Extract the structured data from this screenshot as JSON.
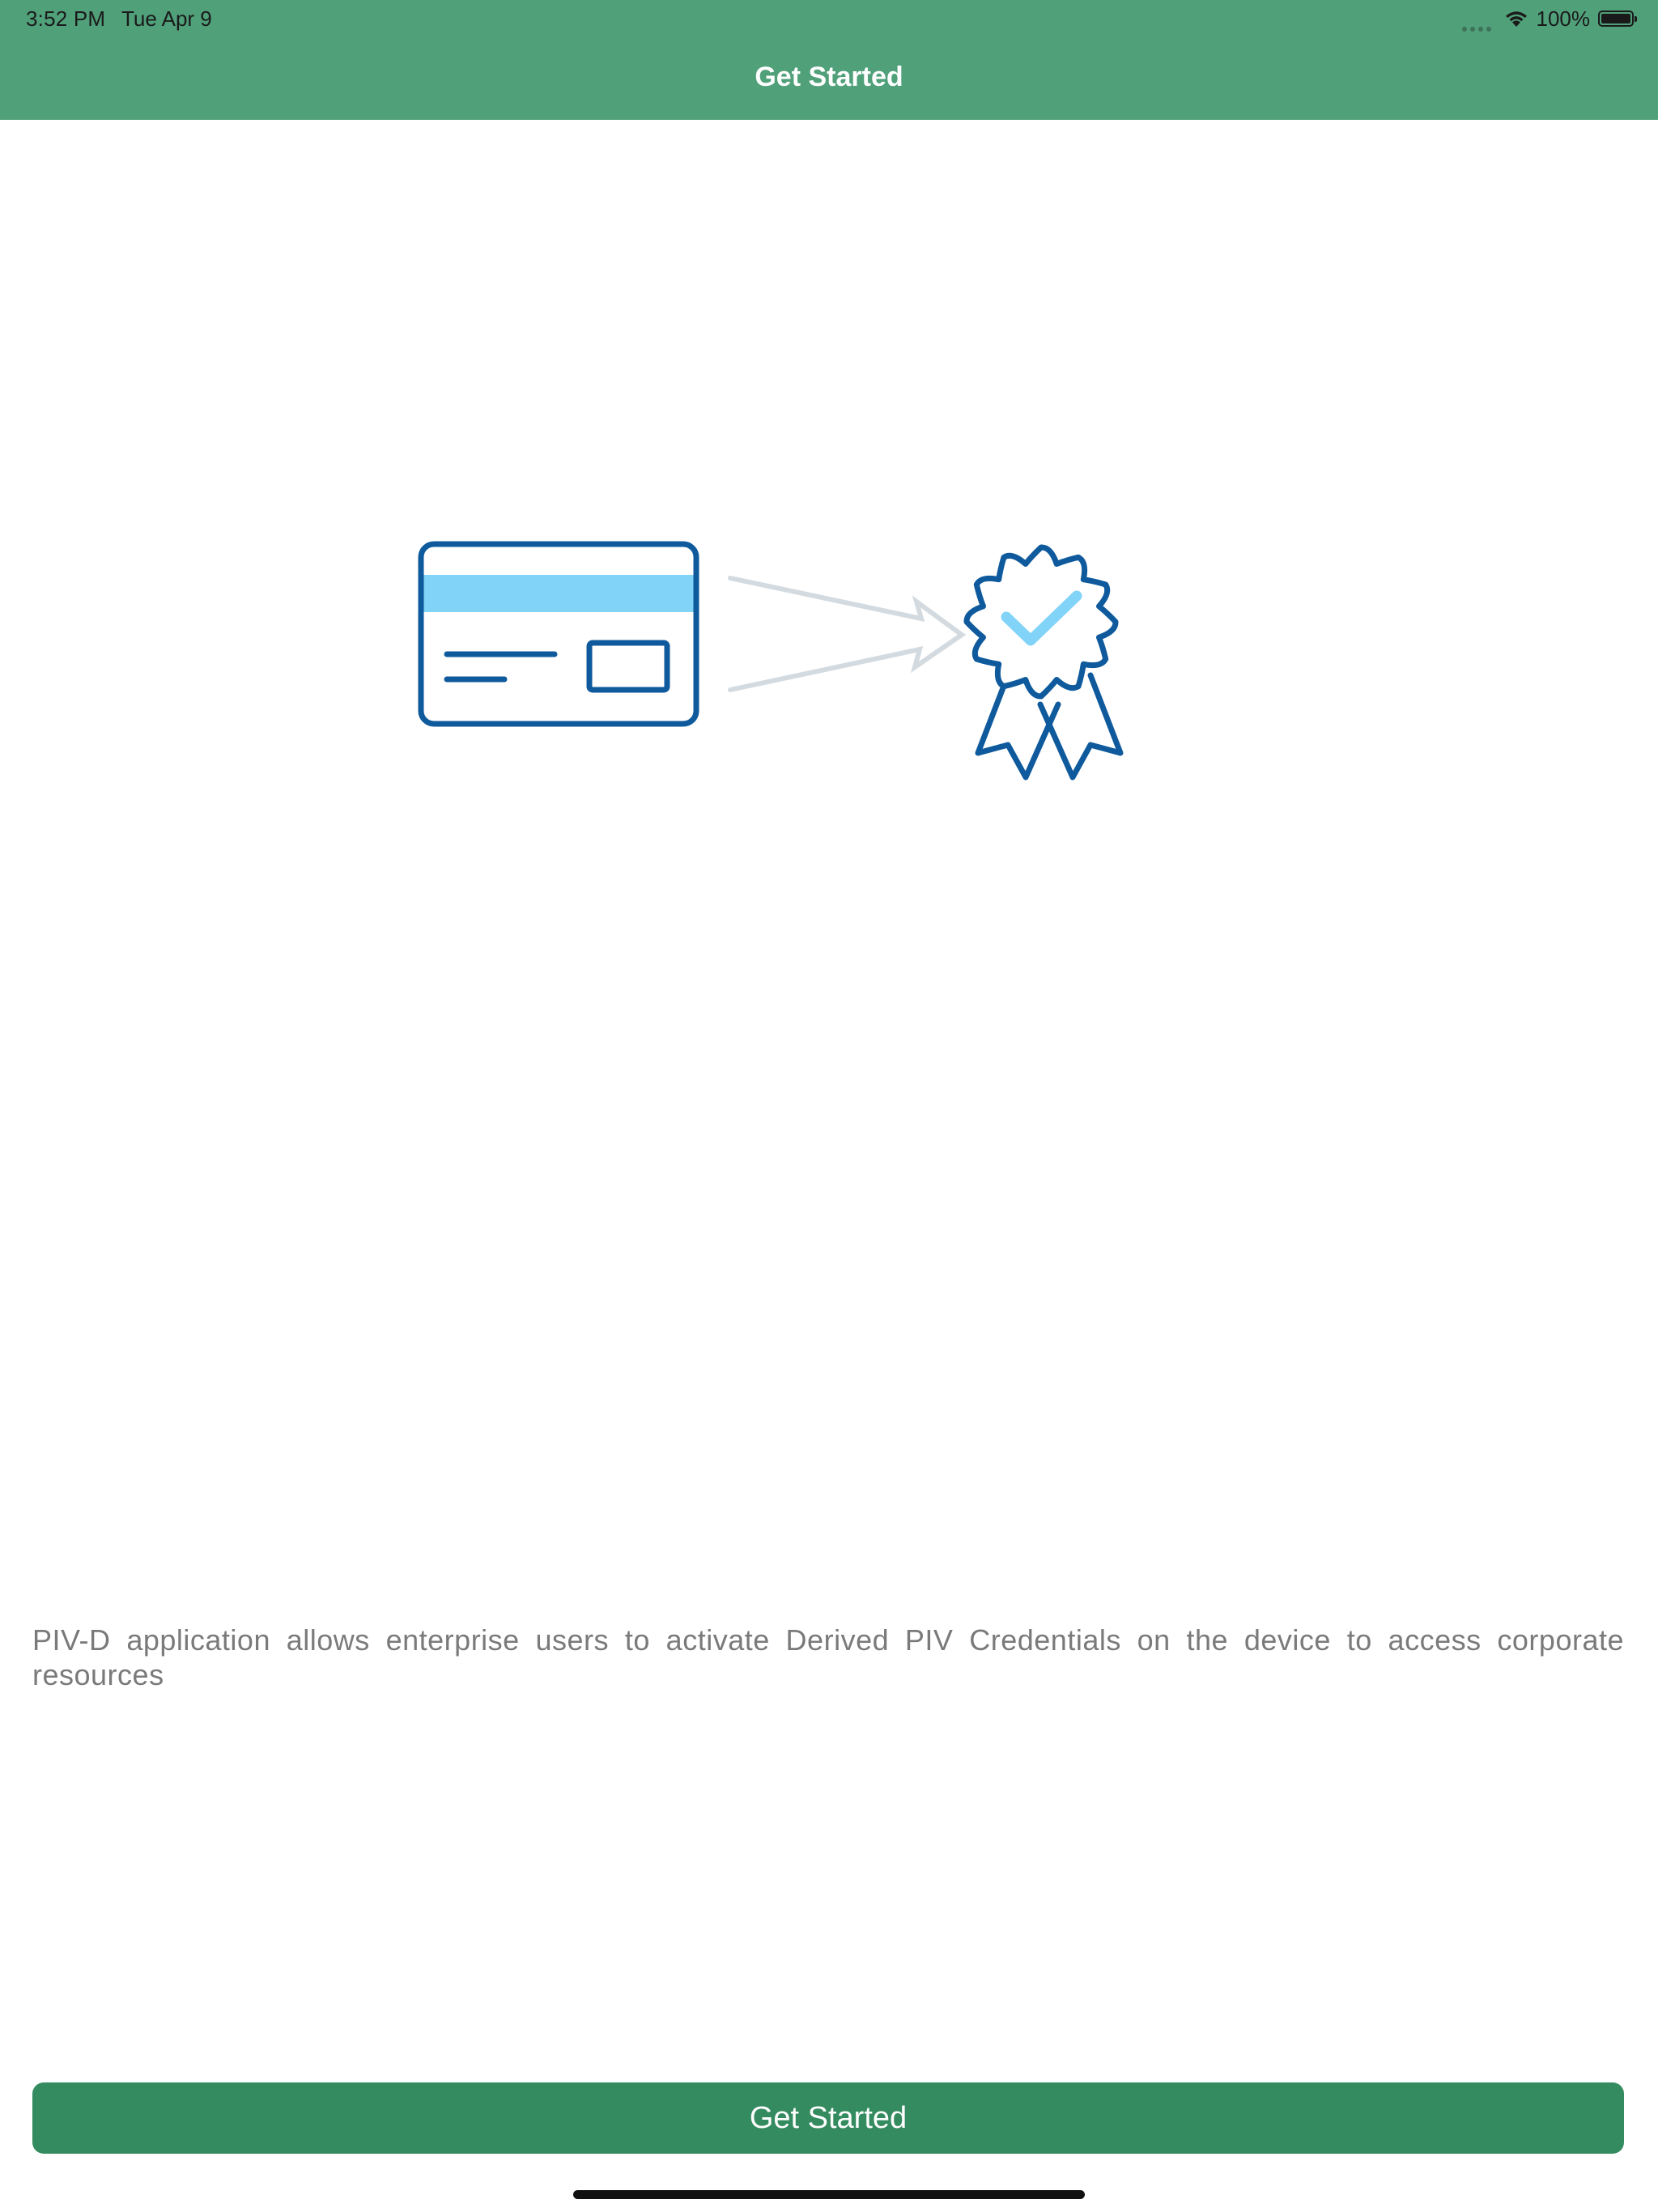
{
  "status_bar": {
    "time": "3:52 PM",
    "date": "Tue Apr 9",
    "battery_percent": "100%",
    "battery_level": 1.0,
    "icons": [
      "cellular-dots-icon",
      "wifi-icon",
      "battery-icon"
    ]
  },
  "nav": {
    "title": "Get Started"
  },
  "illustration": {
    "icons": [
      "id-card-icon",
      "arrow-right-icon",
      "certificate-badge-icon"
    ],
    "colors": {
      "primary_blue": "#0f5a9c",
      "light_blue": "#82d3f8",
      "arrow_gray": "#d3dbe1"
    }
  },
  "main": {
    "description": "PIV-D application allows enterprise users to activate Derived PIV Credentials on the device to access corporate resources"
  },
  "footer": {
    "button_label": "Get Started"
  },
  "colors": {
    "header_bg": "#50a07a",
    "button_bg": "#338b5f",
    "text_muted": "#7a7a7a"
  }
}
